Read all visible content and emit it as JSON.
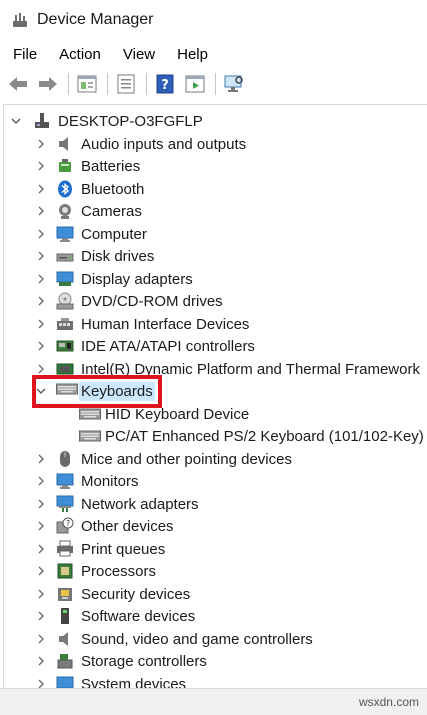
{
  "window": {
    "title": "Device Manager"
  },
  "menu": [
    "File",
    "Action",
    "View",
    "Help"
  ],
  "toolbar": [
    "back-arrow-icon",
    "forward-arrow-icon",
    "properties-icon",
    "update-driver-icon",
    "help-icon",
    "run-icon",
    "scan-hardware-icon"
  ],
  "tree": {
    "root": "DESKTOP-O3FGFLP",
    "items": [
      {
        "label": "Audio inputs and outputs",
        "icon": "speaker-icon"
      },
      {
        "label": "Batteries",
        "icon": "battery-icon"
      },
      {
        "label": "Bluetooth",
        "icon": "bluetooth-icon"
      },
      {
        "label": "Cameras",
        "icon": "camera-icon"
      },
      {
        "label": "Computer",
        "icon": "computer-icon"
      },
      {
        "label": "Disk drives",
        "icon": "disk-drive-icon"
      },
      {
        "label": "Display adapters",
        "icon": "display-adapter-icon"
      },
      {
        "label": "DVD/CD-ROM drives",
        "icon": "dvd-drive-icon"
      },
      {
        "label": "Human Interface Devices",
        "icon": "hid-icon"
      },
      {
        "label": "IDE ATA/ATAPI controllers",
        "icon": "ide-controller-icon"
      },
      {
        "label": "Intel(R) Dynamic Platform and Thermal Framework",
        "icon": "chip-icon"
      },
      {
        "label": "Keyboards",
        "icon": "keyboard-icon",
        "expanded": true,
        "selected": true,
        "children": [
          "HID Keyboard Device",
          "PC/AT Enhanced PS/2 Keyboard (101/102-Key)"
        ]
      },
      {
        "label": "Mice and other pointing devices",
        "icon": "mouse-icon"
      },
      {
        "label": "Monitors",
        "icon": "monitor-icon"
      },
      {
        "label": "Network adapters",
        "icon": "network-adapter-icon"
      },
      {
        "label": "Other devices",
        "icon": "unknown-device-icon"
      },
      {
        "label": "Print queues",
        "icon": "printer-icon"
      },
      {
        "label": "Processors",
        "icon": "processor-icon"
      },
      {
        "label": "Security devices",
        "icon": "security-device-icon"
      },
      {
        "label": "Software devices",
        "icon": "software-device-icon"
      },
      {
        "label": "Sound, video and game controllers",
        "icon": "sound-controller-icon"
      },
      {
        "label": "Storage controllers",
        "icon": "storage-controller-icon"
      },
      {
        "label": "System devices",
        "icon": "system-device-icon"
      }
    ]
  },
  "watermark": "wsxdn.com",
  "colors": {
    "selection": "#cce8ff",
    "highlight_box": "#e0141e"
  }
}
